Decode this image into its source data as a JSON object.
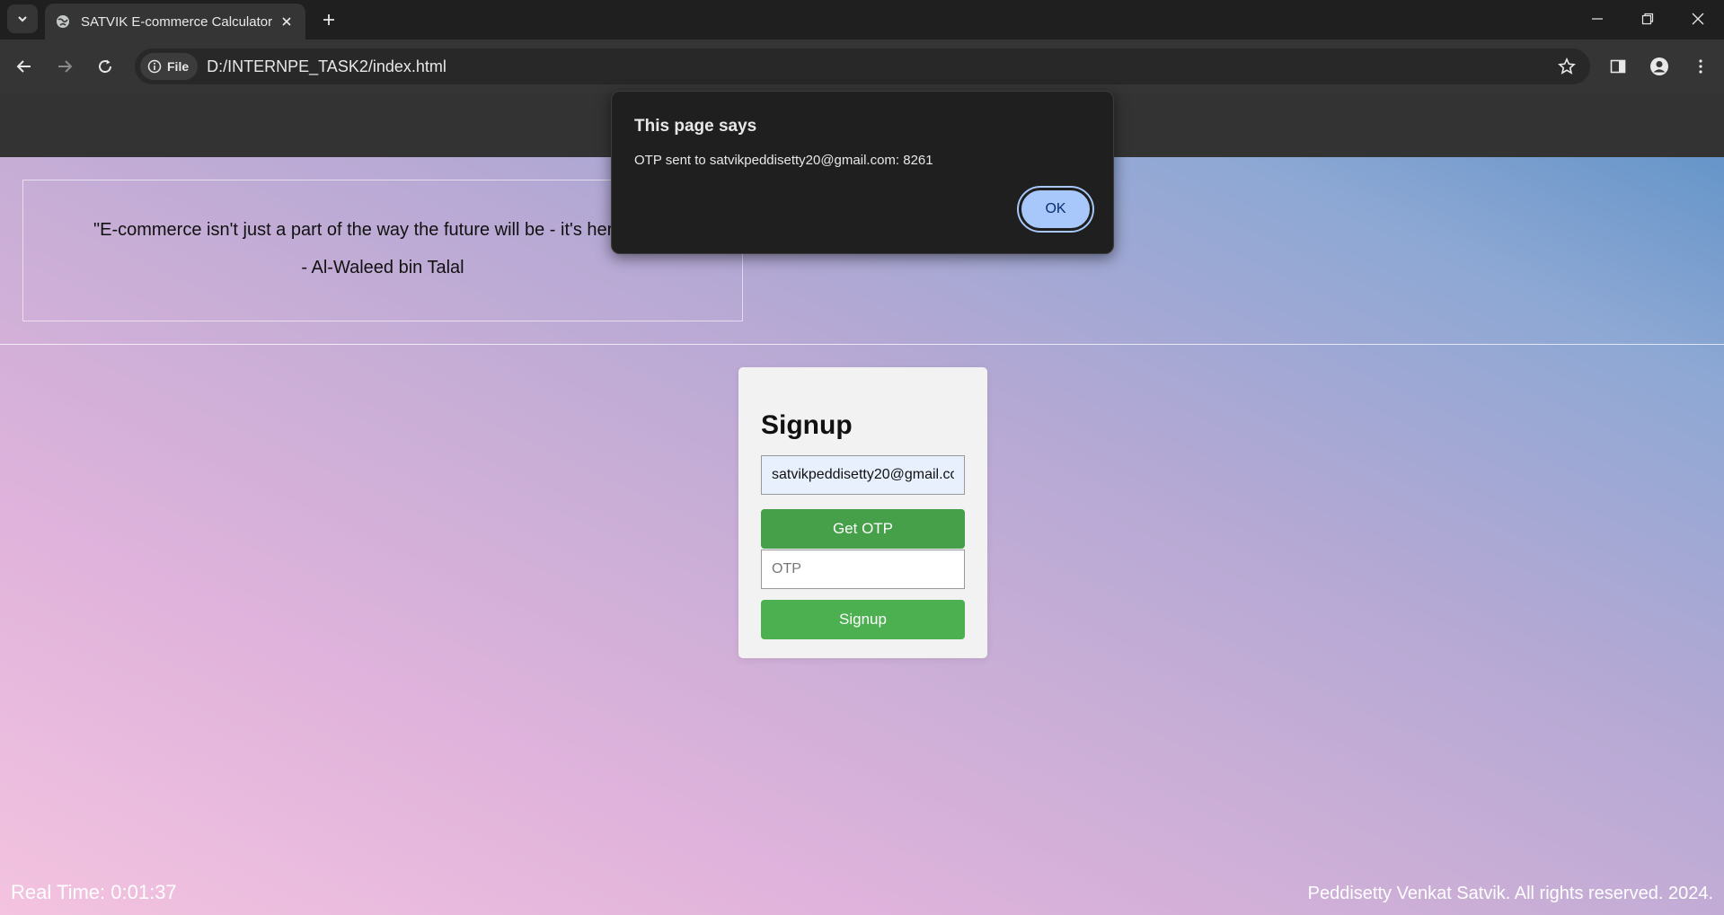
{
  "browser": {
    "tab_title": "SATVIK E-commerce Calculator",
    "site_chip": "File",
    "url": "D:/INTERNPE_TASK2/index.html"
  },
  "page": {
    "quote": "\"E-commerce isn't just a part of the way the future will be - it's here.\"",
    "quote_author": "- Al-Waleed bin Talal",
    "signup": {
      "title": "Signup",
      "email_value": "satvikpeddisetty20@gmail.com",
      "get_otp_label": "Get OTP",
      "otp_placeholder": "OTP",
      "signup_label": "Signup"
    },
    "footer": {
      "real_time": "Real Time: 0:01:37",
      "copyright": "Peddisetty Venkat Satvik. All rights reserved. 2024."
    }
  },
  "dialog": {
    "title": "This page says",
    "message": "OTP sent to satvikpeddisetty20@gmail.com: 8261",
    "ok_label": "OK"
  },
  "colors": {
    "button_green": "#4caf50",
    "dialog_ok": "#a8c7fa",
    "chrome_dark": "#1f1f1f"
  }
}
